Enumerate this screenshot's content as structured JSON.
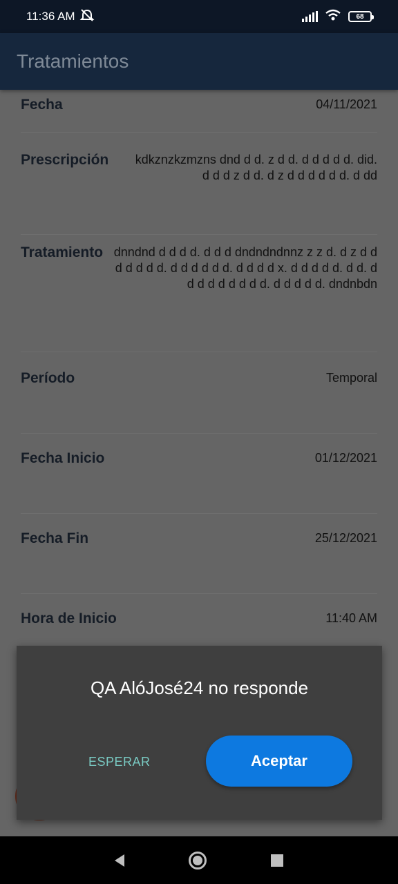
{
  "status_bar": {
    "time": "11:36 AM",
    "icons": [
      "alarm-off-icon",
      "signal-icon",
      "wifi-icon",
      "battery-icon"
    ],
    "battery": "68"
  },
  "app_bar": {
    "title": "Tratamientos"
  },
  "rows": [
    {
      "label": "Fecha",
      "value": "04/11/2021"
    },
    {
      "label": "Prescripción",
      "value": "kdkznzkzmzns dnd d d. z d d. d d d d d. did. d d d z d d. d z d d d d d d. d dd"
    },
    {
      "label": "Tratamiento",
      "value": "dnndnd d d d d. d d d dndndndnnz z z d. d z d d d d d d d. d d d d d d. d d d d x. d d d d d.  d d. d d d d d d d d d. d d d d d. dndnbdn"
    },
    {
      "label": "Período",
      "value": "Temporal"
    },
    {
      "label": "Fecha Inicio",
      "value": "01/12/2021"
    },
    {
      "label": "Fecha Fin",
      "value": "25/12/2021"
    },
    {
      "label": "Hora de Inicio",
      "value": "11:40 AM"
    }
  ],
  "dialog": {
    "title": "QA AlóJosé24 no responde",
    "wait_label": "ESPERAR",
    "accept_label": "Aceptar"
  },
  "nav_bar": {
    "icons": [
      "back-icon",
      "home-icon",
      "recents-icon"
    ]
  },
  "colors": {
    "status_bar": "#0d1726",
    "app_bar": "#16273d",
    "scrim": "#656565",
    "dialog": "#3f3f3f",
    "accept_button": "#0d79e0",
    "wait_text": "#79c9c2"
  }
}
